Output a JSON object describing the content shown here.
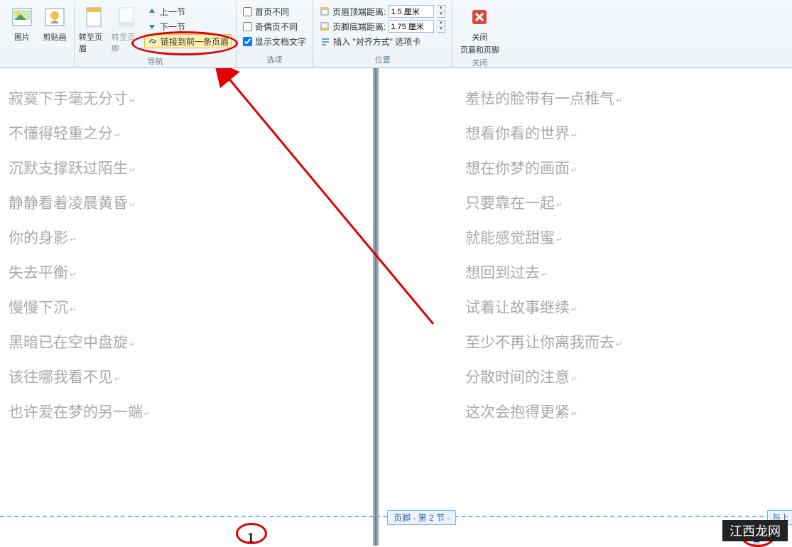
{
  "ribbon": {
    "groups": {
      "insert": {
        "pictures": "图片",
        "clipart": "剪贴画"
      },
      "nav": {
        "label": "导航",
        "goto_header": "转至页眉",
        "goto_footer": "转至页脚",
        "prev_section": "上一节",
        "next_section": "下一节",
        "link_prev": "链接到前一条页眉"
      },
      "options": {
        "label": "选项",
        "first_diff": "首页不同",
        "odd_even_diff": "奇偶页不同",
        "show_doc_text": "显示文档文字",
        "show_doc_checked": true
      },
      "position": {
        "label": "位置",
        "header_dist": "页眉顶端距离:",
        "header_val": "1.5 厘米",
        "footer_dist": "页脚底端距离:",
        "footer_val": "1.75 厘米",
        "insert_align": "插入 \"对齐方式\" 选项卡"
      },
      "close": {
        "label": "关闭",
        "close_hf_line1": "关闭",
        "close_hf_line2": "页眉和页脚"
      }
    }
  },
  "document": {
    "left_page": [
      "寂寞下手毫无分寸",
      "不懂得轻重之分",
      "沉默支撑跃过陌生",
      "静静看着凌晨黄昏",
      "你的身影",
      "失去平衡",
      "慢慢下沉",
      "黑暗已在空中盘旋",
      "该往哪我看不见",
      "也许爱在梦的另一端"
    ],
    "right_page": [
      "羞怯的脸带有一点稚气",
      "想看你看的世界",
      "想在你梦的画面",
      "只要靠在一起",
      "就能感觉甜蜜",
      "想回到过去",
      "试着让故事继续",
      "至少不再让你离我而去",
      "分散时间的注意",
      "这次会抱得更紧"
    ],
    "footer_tab": "页脚 - 第 2 节 -",
    "link_prev_tab": "与上",
    "page_num_left": "1",
    "page_num_right": "1"
  },
  "watermark": "江西龙网"
}
